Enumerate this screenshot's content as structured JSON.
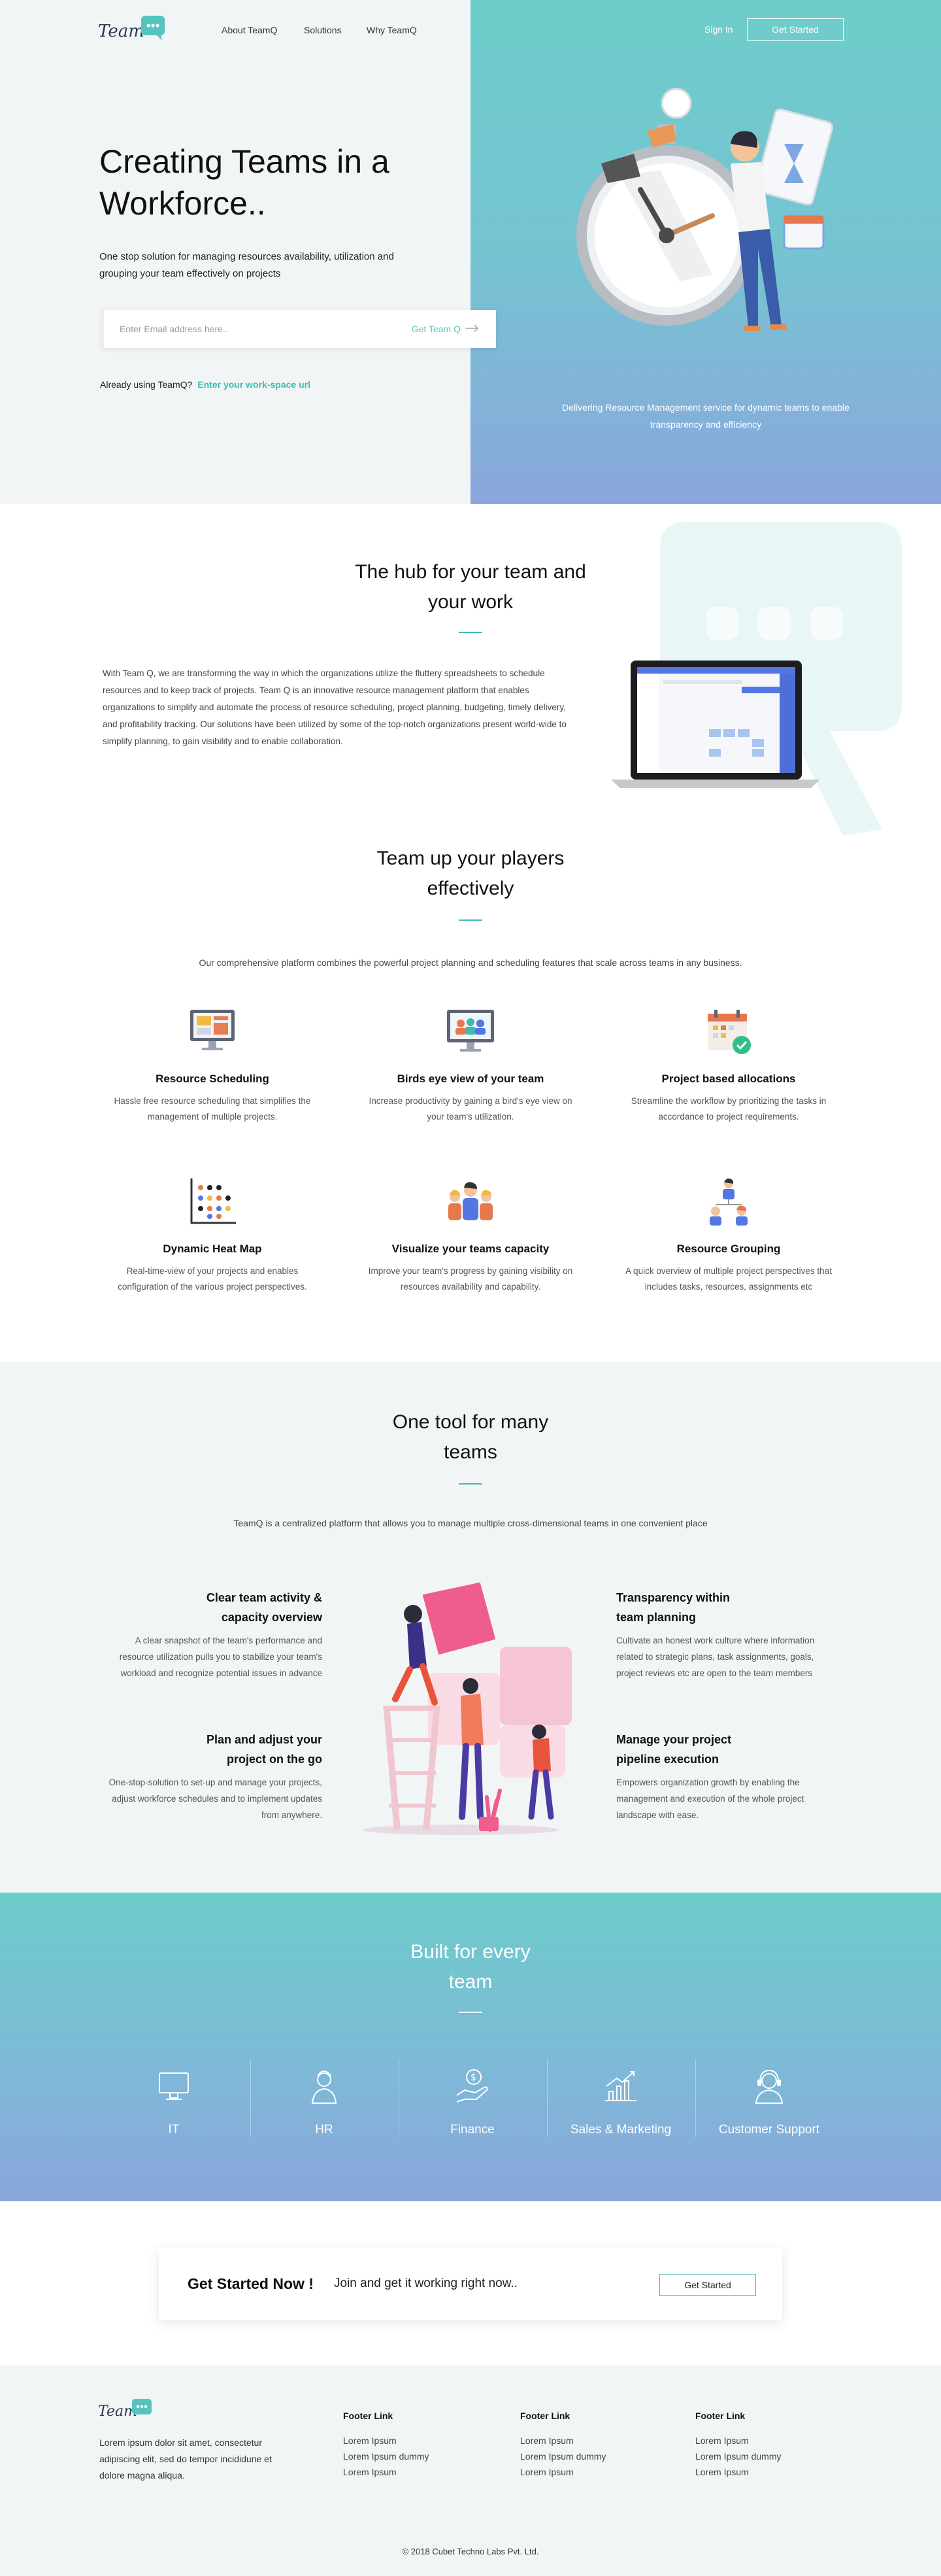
{
  "nav": {
    "logo_text": "Team",
    "links": [
      "About TeamQ",
      "Solutions",
      "Why TeamQ"
    ],
    "sign_in": "Sign In",
    "get_started": "Get Started"
  },
  "hero": {
    "title_line1": "Creating Teams in a",
    "title_line2": "Workforce..",
    "subtitle": "One stop solution for managing resources availability, utilization and grouping your team effectively on projects",
    "email_placeholder": "Enter Email address here..",
    "email_button": "Get Team Q",
    "already_text": "Already using TeamQ?",
    "already_link": "Enter your work-space url",
    "caption": "Delivering Resource Management service for dynamic teams to enable transparency and efficiency"
  },
  "hub": {
    "title_line1": "The hub for your team and",
    "title_line2": "your work",
    "text": "With Team Q, we are transforming the way in which the organizations utilize the fluttery spreadsheets to schedule resources and to keep track of projects. Team Q is an innovative resource management platform that enables organizations to simplify and automate the process of resource scheduling, project planning, budgeting, timely delivery, and profitability tracking. Our solutions have been utilized by some of the top-notch organizations present world-wide to simplify planning, to gain visibility and to enable collaboration."
  },
  "features": {
    "title_line1": "Team up your players",
    "title_line2": "effectively",
    "intro": "Our comprehensive platform combines the powerful project planning and scheduling features that scale across teams in any business.",
    "items": [
      {
        "title": "Resource Scheduling",
        "text": "Hassle free resource scheduling that simplifies the management of multiple projects."
      },
      {
        "title": "Birds eye view of your team",
        "text": "Increase productivity by gaining a bird's eye view on your team's utilization."
      },
      {
        "title": "Project based allocations",
        "text": "Streamline the workflow by prioritizing the tasks in accordance to project requirements."
      },
      {
        "title": "Dynamic Heat Map",
        "text": "Real-time-view of your projects and enables configuration of the various project perspectives."
      },
      {
        "title": "Visualize your teams capacity",
        "text": "Improve your team's progress by gaining visibility on resources availability and capability."
      },
      {
        "title": "Resource Grouping",
        "text": "A quick overview of multiple project perspectives that includes tasks, resources, assignments etc"
      }
    ]
  },
  "tool": {
    "title_line1": "One tool for many",
    "title_line2": "teams",
    "intro": "TeamQ is a centralized platform that allows you to manage multiple cross-dimensional teams in one convenient place",
    "items": [
      {
        "title1": "Clear team activity &",
        "title2": "capacity overview",
        "text": "A clear snapshot of the team's performance and resource utilization pulls you to stabilize your team's workload and recognize potential issues in advance"
      },
      {
        "title1": "Transparency within",
        "title2": "team planning",
        "text": "Cultivate an honest work culture where information related to strategic plans, task assignments, goals, project reviews etc are open to the team members"
      },
      {
        "title1": "Plan and adjust your",
        "title2": "project on the go",
        "text": "One-stop-solution to set-up and manage your projects, adjust workforce schedules and to implement updates from anywhere."
      },
      {
        "title1": "Manage your project",
        "title2": "pipeline execution",
        "text": "Empowers organization growth by enabling the management and execution of the whole project landscape with ease."
      }
    ]
  },
  "built": {
    "title_line1": "Built for every",
    "title_line2": "team",
    "teams": [
      "IT",
      "HR",
      "Finance",
      "Sales & Marketing",
      "Customer Support"
    ]
  },
  "cta": {
    "title": "Get Started Now !",
    "text": "Join and get it working right now..",
    "button": "Get Started"
  },
  "footer": {
    "about": "Lorem ipsum dolor sit amet, consectetur adipiscing elit, sed do tempor incididune et dolore magna aliqua.",
    "columns": [
      {
        "heading": "Footer Link",
        "links": [
          "Lorem Ipsum",
          "Lorem Ipsum dummy",
          "Lorem Ipsum"
        ]
      },
      {
        "heading": "Footer Link",
        "links": [
          "Lorem Ipsum",
          "Lorem Ipsum dummy",
          "Lorem Ipsum"
        ]
      },
      {
        "heading": "Footer Link",
        "links": [
          "Lorem Ipsum",
          "Lorem Ipsum dummy",
          "Lorem Ipsum"
        ]
      }
    ],
    "copyright": "© 2018 Cubet Techno Labs Pvt. Ltd."
  },
  "colors": {
    "accent": "#3fbbb2",
    "teal": "#6dcdca",
    "periwinkle": "#8aa6dc",
    "light_bg": "#f2f5f6"
  }
}
